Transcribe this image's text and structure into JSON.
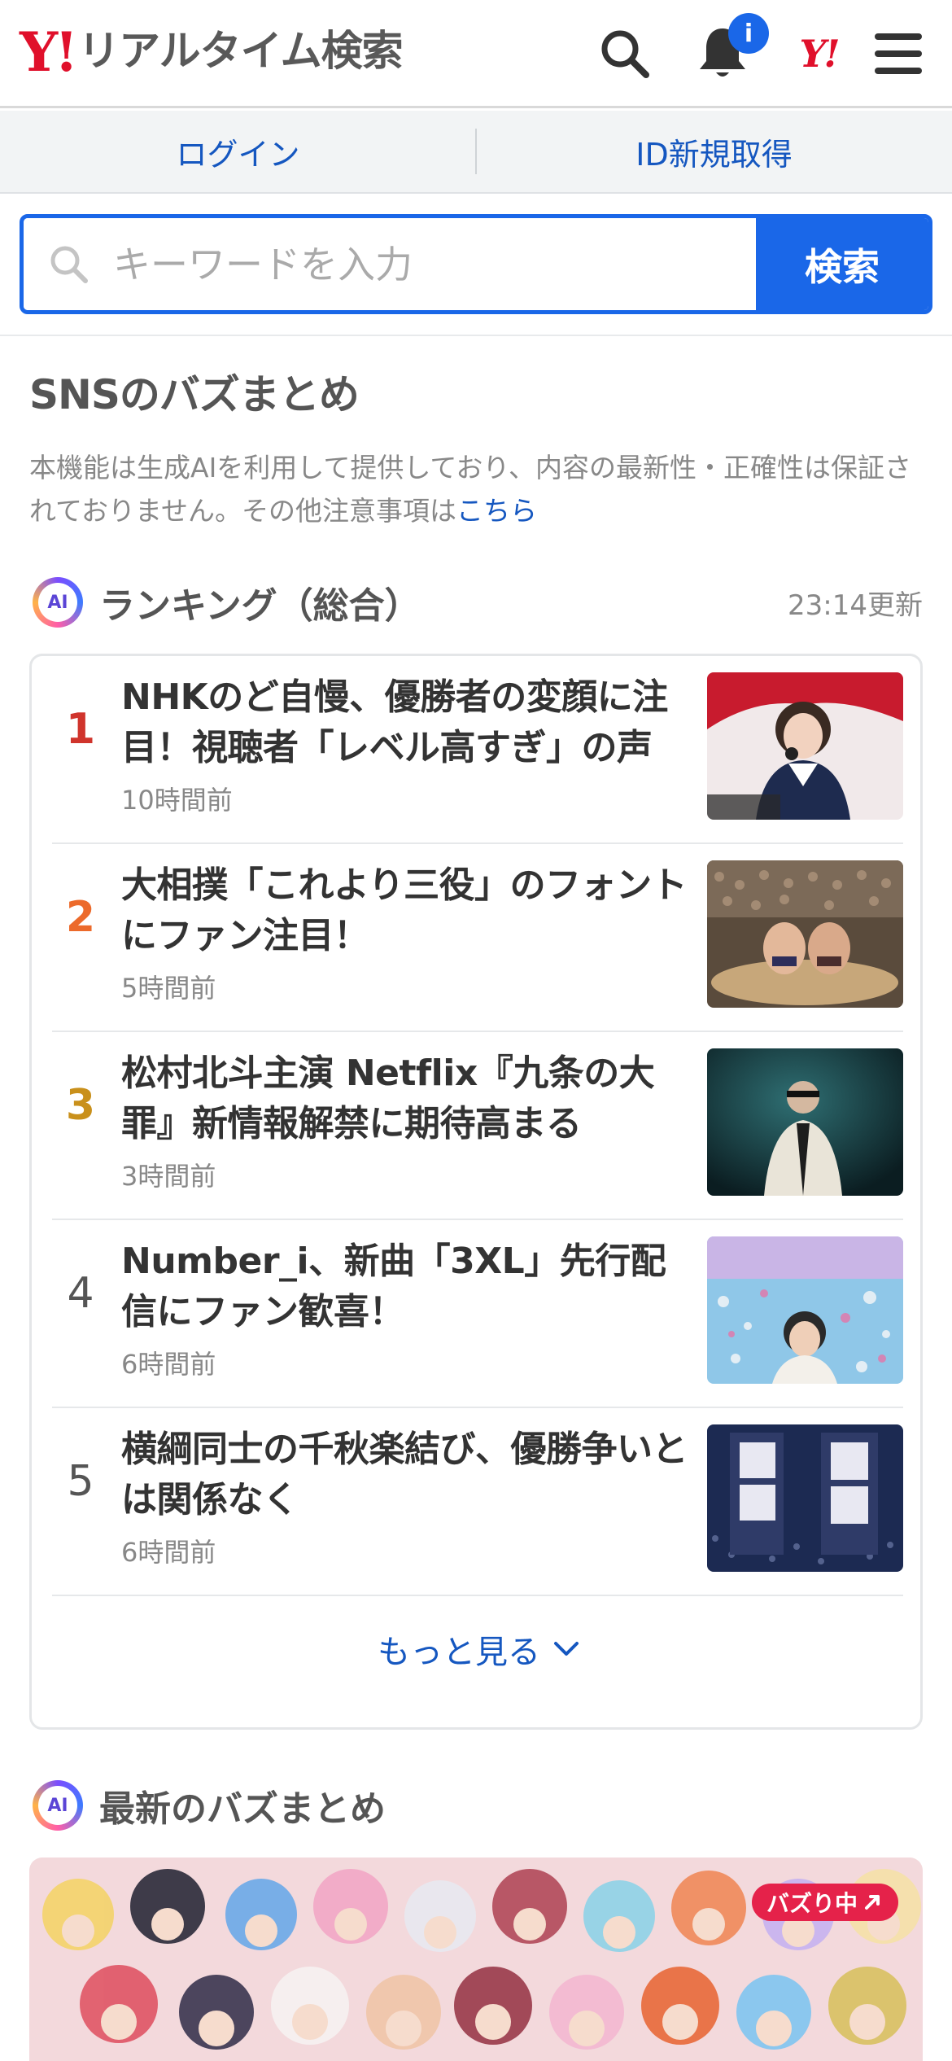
{
  "header": {
    "logo_mark": "Y!",
    "logo_text": "リアルタイム検索",
    "notification_badge": "i",
    "yj_mark": "Y!"
  },
  "auth": {
    "login_label": "ログイン",
    "signup_label": "ID新規取得"
  },
  "search": {
    "placeholder": "キーワードを入力",
    "button_label": "検索"
  },
  "section": {
    "title": "SNSのバズまとめ",
    "disclaimer": "本機能は生成AIを利用して提供しており、内容の最新性・正確性は保証されておりません。その他注意事項は",
    "disclaimer_link": "こちら"
  },
  "ranking": {
    "ai_label": "AI",
    "title": "ランキング（総合）",
    "updated": "23:14更新",
    "items": [
      {
        "rank": "1",
        "title": "NHKのど自慢、優勝者の変顔に注目！視聴者「レベル高すぎ」の声",
        "time": "10時間前",
        "rank_color": "#d0342c"
      },
      {
        "rank": "2",
        "title": "大相撲「これより三役」のフォントにファン注目！",
        "time": "5時間前",
        "rank_color": "#ec6a2b"
      },
      {
        "rank": "3",
        "title": "松村北斗主演 Netflix『九条の大罪』新情報解禁に期待高まる",
        "time": "3時間前",
        "rank_color": "#c9901b"
      },
      {
        "rank": "4",
        "title": "Number_i、新曲「3XL」先行配信にファン歓喜！",
        "time": "6時間前",
        "rank_color": "#555555"
      },
      {
        "rank": "5",
        "title": "横綱同士の千秋楽結び、優勝争いとは関係なく",
        "time": "6時間前",
        "rank_color": "#555555"
      }
    ],
    "more_label": "もっと見る"
  },
  "latest": {
    "ai_label": "AI",
    "title": "最新のバズまとめ",
    "badge": "バズり中"
  },
  "colors": {
    "accent": "#1a67e8",
    "brand": "#e0102b",
    "link": "#1557c0"
  }
}
